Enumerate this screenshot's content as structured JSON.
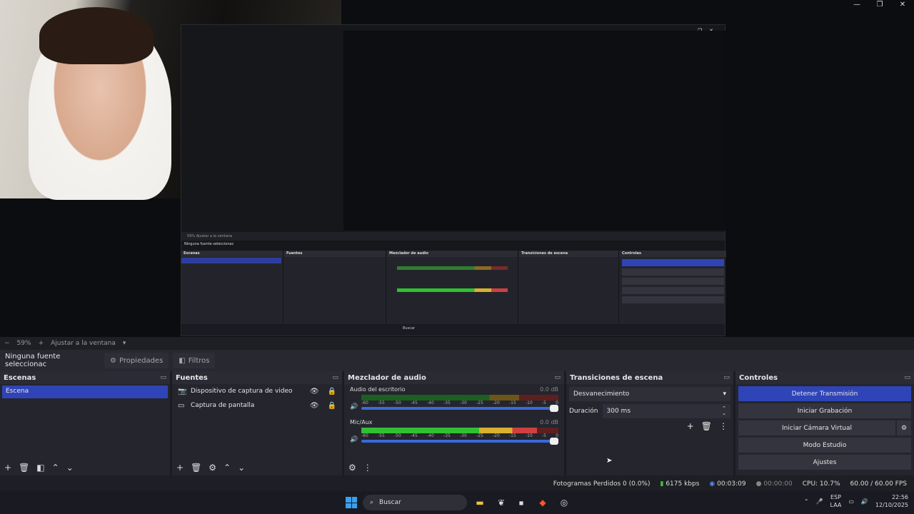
{
  "window": {
    "minimize": "—",
    "maximize": "❐",
    "close": "✕"
  },
  "zoom": {
    "minus": "−",
    "percent": "59%",
    "plus": "+",
    "fit": "Ajustar a la ventana",
    "dropdown": "▾"
  },
  "source_bar": {
    "no_selection": "Ninguna fuente seleccionac",
    "properties": "Propiedades",
    "filters": "Filtros"
  },
  "scenes": {
    "title": "Escenas",
    "items": [
      "Escena"
    ]
  },
  "sources": {
    "title": "Fuentes",
    "items": [
      {
        "label": "Dispositivo de captura de video"
      },
      {
        "label": "Captura de pantalla"
      }
    ]
  },
  "mixer": {
    "title": "Mezclador de audio",
    "channels": [
      {
        "name": "Audio del escritorio",
        "db": "0.0 dB",
        "level": 0.0
      },
      {
        "name": "Mic/Aux",
        "db": "0.0 dB",
        "level": 0.89
      }
    ],
    "scale": [
      "-60",
      "-55",
      "-50",
      "-45",
      "-40",
      "-35",
      "-30",
      "-25",
      "-20",
      "-15",
      "-10",
      "-5",
      "0"
    ]
  },
  "transitions": {
    "title": "Transiciones de escena",
    "type": "Desvanecimiento",
    "duration_label": "Duración",
    "duration_value": "300 ms"
  },
  "controls": {
    "title": "Controles",
    "buttons": [
      "Detener Transmisión",
      "Iniciar Grabación",
      "Iniciar Cámara Virtual",
      "Modo Estudio",
      "Ajustes"
    ]
  },
  "status": {
    "dropped": "Fotogramas Perdidos 0 (0.0%)",
    "bitrate": "6175 kbps",
    "stream_time": "00:03:09",
    "rec_time": "00:00:00",
    "cpu": "CPU: 10.7%",
    "fps": "60.00 / 60.00 FPS"
  },
  "taskbar": {
    "search": "Buscar",
    "lang_top": "ESP",
    "lang_bottom": "LAA",
    "time": "22:56",
    "date": "12/10/2025"
  },
  "nested": {
    "no_selection": "Ninguna fuente seleccionac",
    "fit": "Ajustar a la ventana",
    "search": "Buscar"
  },
  "colors": {
    "accent": "#2f44b7",
    "panel": "#24252d",
    "bg": "#1e1f25"
  }
}
